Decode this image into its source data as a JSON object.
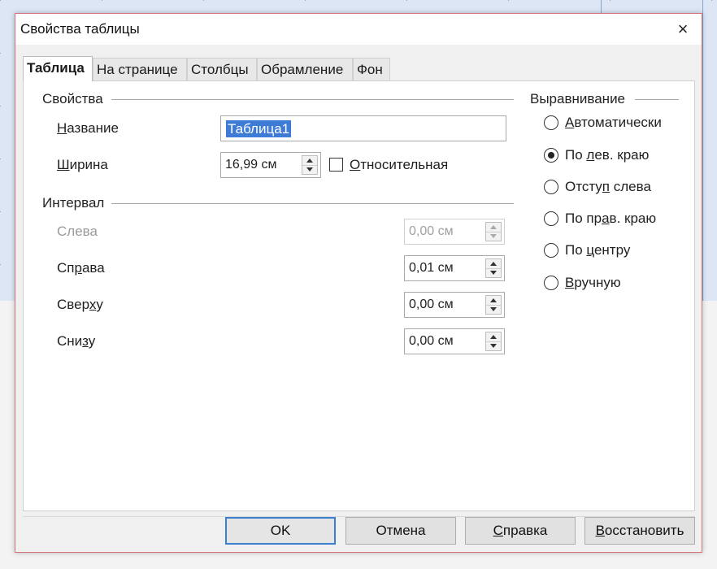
{
  "dialog": {
    "title": "Свойства таблицы",
    "close_icon": "×"
  },
  "tabs": [
    {
      "label": "Таблица",
      "active": true
    },
    {
      "label": "На странице",
      "active": false
    },
    {
      "label": "Столбцы",
      "active": false
    },
    {
      "label": "Обрамление",
      "active": false
    },
    {
      "label": "Фон",
      "active": false
    }
  ],
  "properties": {
    "section_title": "Свойства",
    "name_label": "Название",
    "name_value": "Таблица1",
    "width_label": "Ширина",
    "width_value": "16,99 см",
    "relative_label": "Относительная",
    "relative_checked": false
  },
  "spacing": {
    "section_title": "Интервал",
    "left_label": "Слева",
    "left_value": "0,00 см",
    "right_label": "Справа",
    "right_value": "0,01 см",
    "top_label": "Сверху",
    "top_value": "0,00 см",
    "bottom_label": "Снизу",
    "bottom_value": "0,00 см"
  },
  "alignment": {
    "section_title": "Выравнивание",
    "options": [
      {
        "label": "Автоматически",
        "selected": false
      },
      {
        "label": "По лев. краю",
        "selected": true
      },
      {
        "label": "Отступ слева",
        "selected": false
      },
      {
        "label": "По прав. краю",
        "selected": false
      },
      {
        "label": "По центру",
        "selected": false
      },
      {
        "label": "Вручную",
        "selected": false
      }
    ]
  },
  "buttons": {
    "ok": "OK",
    "cancel": "Отмена",
    "help": "Справка",
    "reset": "Восстановить"
  },
  "colors": {
    "accent": "#3c7fd0",
    "selection": "#3d7bd6",
    "border_red": "#d4737a"
  }
}
